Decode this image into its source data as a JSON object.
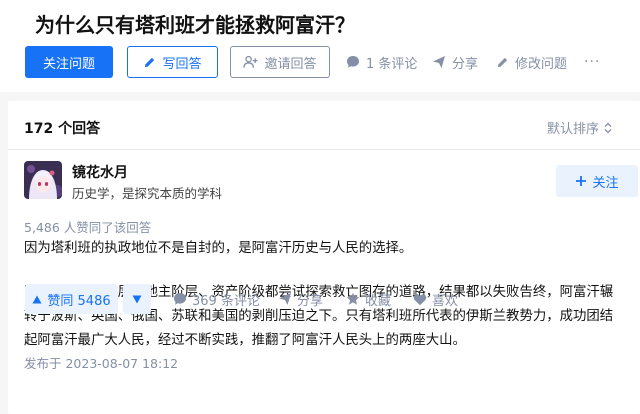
{
  "question": {
    "title": "为什么只有塔利班才能拯救阿富汗？",
    "follow_label": "关注问题",
    "write_label": "写回答",
    "invite_label": "邀请回答",
    "comments_label": "1 条评论",
    "share_label": "分享",
    "edit_label": "修改问题",
    "more_label": "···"
  },
  "answers_header": {
    "count_label": "172 个回答",
    "sort_label": "默认排序"
  },
  "answer": {
    "author_name": "镜花水月",
    "author_bio": "历史学，是探究本质的学科",
    "follow_label": "关注",
    "vote_summary": "5,486 人赞同了该回答",
    "paragraph_1": "因为塔利班的执政地位不是自封的，是阿富汗历史与人民的选择。",
    "paragraph_2": "阿富汗的农民阶层、地主阶层、资产阶级都尝试探索救亡图存的道路，结果都以失败告终，阿富汗辗转于波斯、英国、俄国、苏联和美国的剥削压迫之下。只有塔利班所代表的伊斯兰教势力，成功团结起阿富汗最广大人民，经过不断实践，推翻了阿富汗人民头上的两座大山。",
    "published": "发布于 2023-08-07 18:12",
    "upvote_label": "赞同 5486",
    "comments_label": "369 条评论",
    "share_label": "分享",
    "collect_label": "收藏",
    "like_label": "喜欢"
  },
  "colors": {
    "brand_blue": "#1772f6",
    "brand_blue_light": "#eaf2fe",
    "muted_gray": "#8590a6",
    "text": "#121212"
  }
}
